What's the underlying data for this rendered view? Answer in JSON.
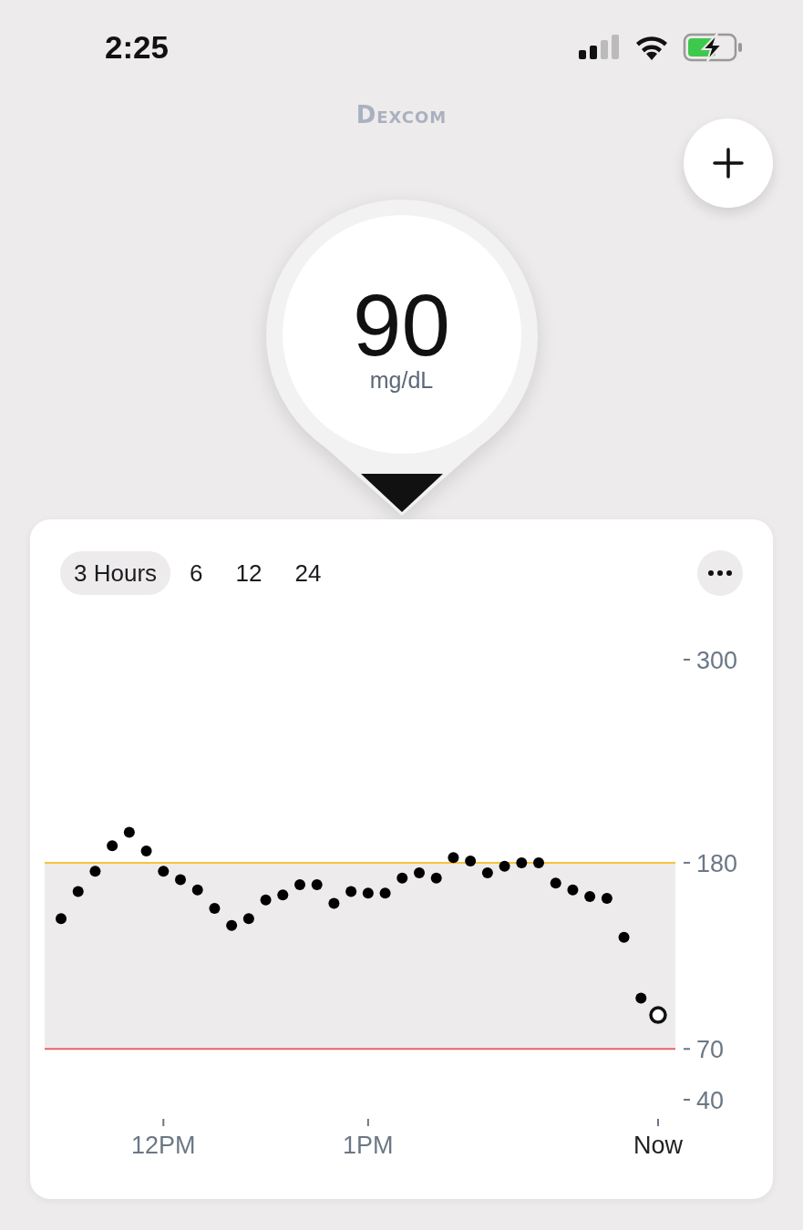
{
  "status_bar": {
    "time": "2:25"
  },
  "logo": "Dexcom",
  "reading": {
    "value": "90",
    "unit": "mg/dL"
  },
  "range_tabs": [
    {
      "label": "3 Hours",
      "selected": true
    },
    {
      "label": "6",
      "selected": false
    },
    {
      "label": "12",
      "selected": false
    },
    {
      "label": "24",
      "selected": false
    }
  ],
  "chart": {
    "chart_data": {
      "type": "scatter",
      "ylim": [
        40,
        300
      ],
      "categories": [
        null,
        null,
        null,
        null,
        null,
        null,
        "12PM",
        null,
        null,
        null,
        null,
        null,
        null,
        null,
        null,
        null,
        null,
        null,
        "1PM",
        null,
        null,
        null,
        null,
        null,
        null,
        null,
        null,
        null,
        null,
        null,
        null,
        null,
        null,
        null,
        null,
        "Now"
      ],
      "series": [
        {
          "color": "#000000",
          "values": [
            147,
            163,
            175,
            190,
            198,
            187,
            175,
            170,
            164,
            153,
            143,
            147,
            158,
            161,
            167,
            167,
            156,
            163,
            162,
            162,
            171,
            174,
            171,
            183,
            181,
            174,
            178,
            180,
            180,
            168,
            164,
            160,
            159,
            136,
            100,
            null
          ]
        },
        {
          "color": "#ffffff",
          "values": [
            null,
            null,
            null,
            null,
            null,
            null,
            null,
            null,
            null,
            null,
            null,
            null,
            null,
            null,
            null,
            null,
            null,
            null,
            null,
            null,
            null,
            null,
            null,
            null,
            null,
            null,
            null,
            null,
            null,
            null,
            null,
            null,
            null,
            null,
            null,
            90
          ]
        }
      ],
      "yticks": [
        300,
        180,
        70,
        40
      ],
      "ref_lines": [
        {
          "axis": "y",
          "value": 180,
          "color": "#f5c342"
        },
        {
          "axis": "y",
          "value": 70,
          "color": "#e8646a"
        }
      ],
      "bands": [
        {
          "axis": "y",
          "from": 70,
          "to": 180,
          "color": "#edebec"
        }
      ]
    }
  }
}
